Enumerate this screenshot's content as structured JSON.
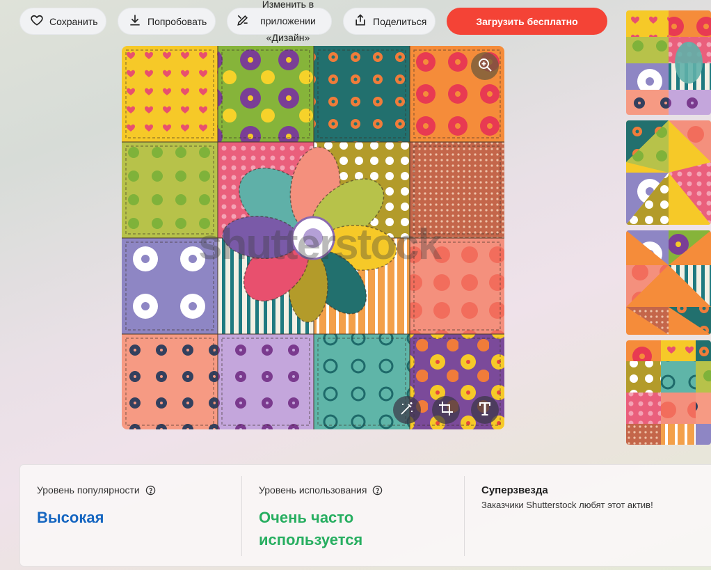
{
  "toolbar": {
    "save_label": "Сохранить",
    "try_label": "Попробовать",
    "design_line1": "Изменить в",
    "design_line2": "приложении",
    "design_line3": "«Дизайн»",
    "share_label": "Поделиться",
    "download_label": "Загрузить бесплатно"
  },
  "image": {
    "watermark": "shutterstock"
  },
  "stats": {
    "popularity_label": "Уровень популярности",
    "popularity_value": "Высокая",
    "usage_label": "Уровень использования",
    "usage_value_line1": "Очень часто",
    "usage_value_line2": "используется",
    "superstar_title": "Суперзвезда",
    "superstar_desc": "Заказчики Shutterstock любят этот актив!"
  },
  "colors": {
    "primary_button": "#f44336",
    "popularity_value": "#1565c0",
    "usage_value": "#27ae60"
  },
  "icons": {
    "save": "heart-icon",
    "try": "download-icon",
    "design": "edit-design-icon",
    "share": "share-icon",
    "zoom": "zoom-in-icon",
    "magic": "magic-wand-icon",
    "crop": "crop-icon",
    "text": "text-icon",
    "help": "question-circle-icon"
  }
}
